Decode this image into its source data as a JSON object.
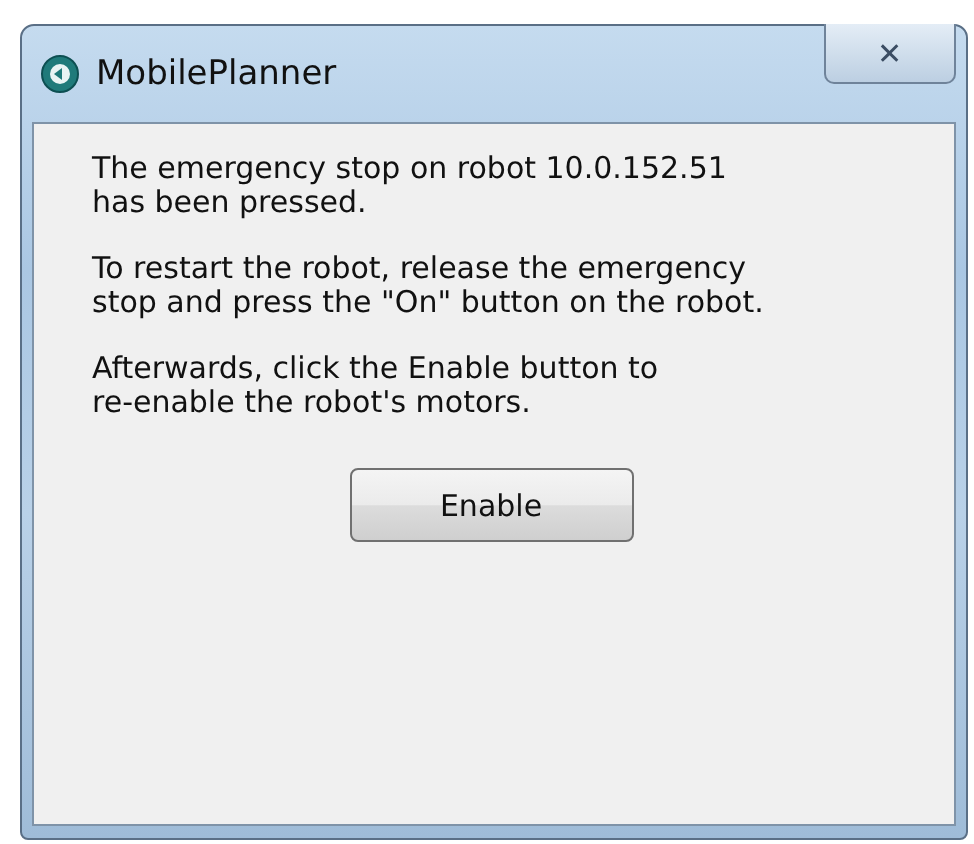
{
  "window": {
    "title": "MobilePlanner",
    "close": "✕"
  },
  "paragraphs": [
    "The emergency stop on robot 10.0.152.51\nhas been pressed.",
    "To restart the robot, release the emergency\nstop and press the \"On\" button on the robot.",
    "Afterwards, click the Enable button to\nre-enable the robot's motors."
  ],
  "buttons": [
    "Enable"
  ]
}
